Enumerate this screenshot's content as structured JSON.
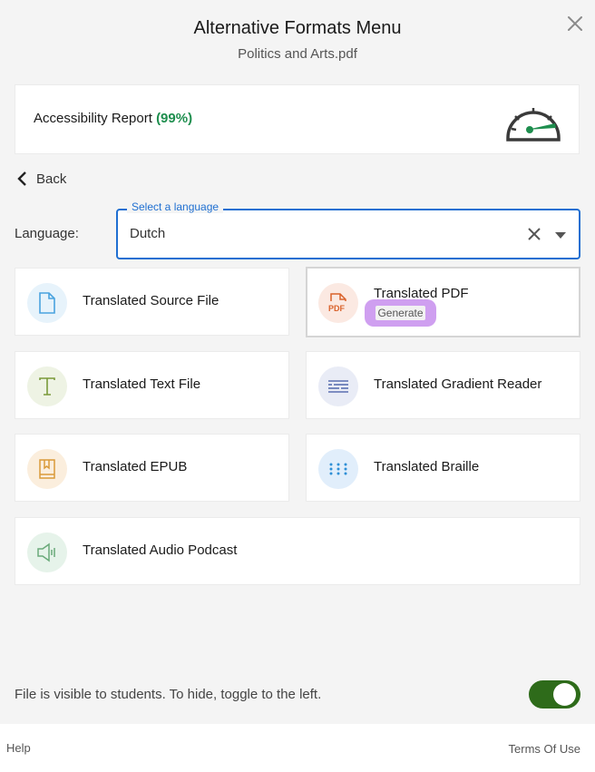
{
  "header": {
    "title": "Alternative Formats Menu",
    "subtitle": "Politics and Arts.pdf",
    "close_icon": "close-icon"
  },
  "report": {
    "label": "Accessibility Report",
    "percent": "(99%)",
    "icon": "gauge-icon",
    "percent_color": "#1e8e4e"
  },
  "back": {
    "label": "Back",
    "icon": "chevron-left-icon"
  },
  "language": {
    "label": "Language:",
    "legend": "Select a language",
    "value": "Dutch",
    "accent_color": "#1f6fd1"
  },
  "formats": [
    {
      "label": "Translated Source File",
      "icon": "file-icon",
      "color": "#4aa3df"
    },
    {
      "label": "Translated PDF",
      "icon": "pdf-icon",
      "color": "#d9622b",
      "selected": true,
      "action": "Generate"
    },
    {
      "label": "Translated Text File",
      "icon": "text-icon",
      "color": "#7a9a3a"
    },
    {
      "label": "Translated Gradient Reader",
      "icon": "gradient-reader-icon",
      "color": "#5a6fb0"
    },
    {
      "label": "Translated EPUB",
      "icon": "book-icon",
      "color": "#d99a3a"
    },
    {
      "label": "Translated Braille",
      "icon": "braille-icon",
      "color": "#2f8fd6"
    },
    {
      "label": "Translated Audio Podcast",
      "icon": "speaker-icon",
      "color": "#6aaa7a"
    }
  ],
  "visibility": {
    "text": "File is visible to students. To hide, toggle to the left.",
    "toggle_on": true,
    "toggle_color": "#2e6b1a"
  },
  "footer": {
    "help": "Help",
    "terms": "Terms Of Use"
  }
}
